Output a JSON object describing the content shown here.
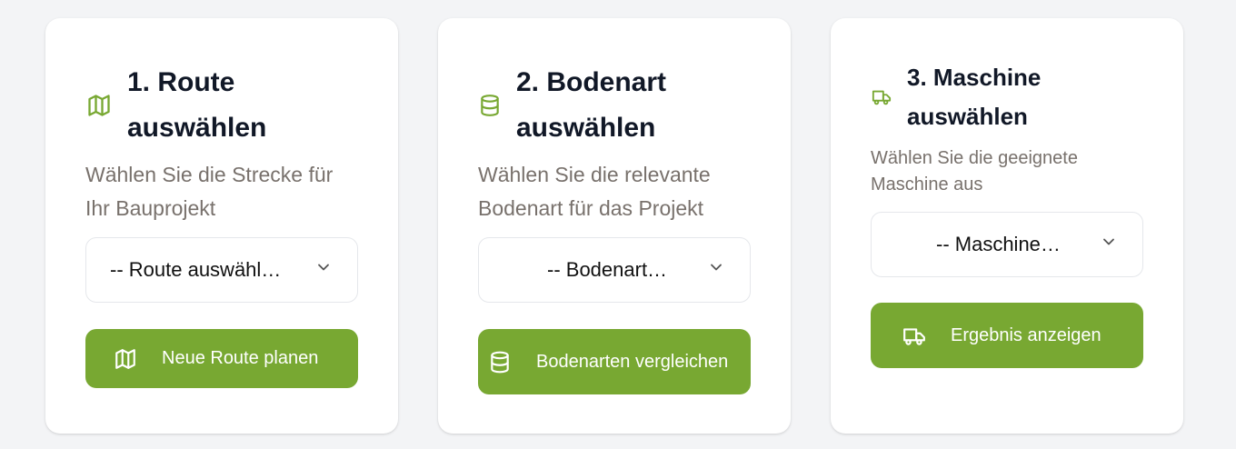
{
  "accent_color": "#78a832",
  "steps": [
    {
      "title_line1": "1. Route",
      "title_line2": "auswählen",
      "icon": "map-icon",
      "description_line1": "Wählen Sie die Strecke für",
      "description_line2": "Ihr Bauprojekt",
      "select_value": "-- Route auswähl…",
      "button_label": "Neue Route planen",
      "button_icon": "map-icon"
    },
    {
      "title_line1": "2. Bodenart",
      "title_line2": "auswählen",
      "icon": "database-icon",
      "description_line1": "Wählen Sie die relevante",
      "description_line2": "Bodenart für das Projekt",
      "select_value": "-- Bodenart…",
      "button_label": "Bodenarten vergleichen",
      "button_icon": "database-icon"
    },
    {
      "title_line1": "3. Maschine",
      "title_line2": "auswählen",
      "icon": "truck-icon",
      "description_line1": "Wählen Sie die geeignete",
      "description_line2": "Maschine aus",
      "select_value": "-- Maschine…",
      "button_label": "Ergebnis anzeigen",
      "button_icon": "truck-icon"
    }
  ]
}
